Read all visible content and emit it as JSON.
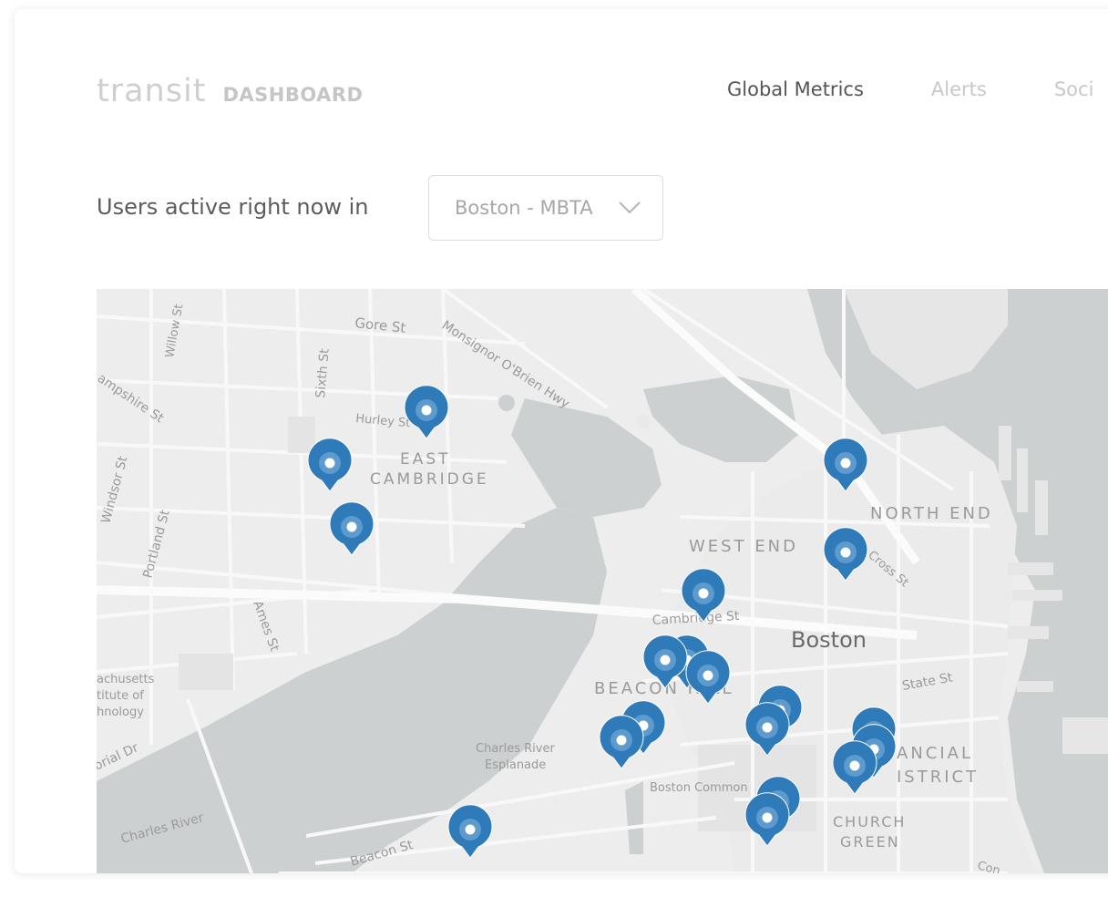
{
  "header": {
    "logo_word": "transit",
    "logo_sub": "DASHBOARD",
    "nav": [
      {
        "label": "Global Metrics",
        "active": true
      },
      {
        "label": "Alerts",
        "active": false
      },
      {
        "label": "Soci",
        "active": false
      }
    ]
  },
  "filter": {
    "prompt": "Users active right now in",
    "selected": "Boston - MBTA"
  },
  "map": {
    "labels": {
      "gore_st": "Gore St",
      "monsignor": "Monsignor O'Brien Hwy",
      "willow_st": "Willow St",
      "sixth_st": "Sixth St",
      "hampshire_st": "ampshire St",
      "hurley_st": "Hurley St",
      "east": "EAST",
      "cambridge": "CAMBRIDGE",
      "windsor_st": "Windsor St",
      "portland_st": "Portland St",
      "north_end": "NORTH END",
      "west_end": "WEST END",
      "cross_st": "Cross St",
      "cambridge_st": "Cambridge St",
      "boston": "Boston",
      "ames_st": "Ames St",
      "mit_1": "achusetts",
      "mit_2": "titute of",
      "mit_3": "hnology",
      "beacon_hill": "BEACON HILL",
      "state_st": "State St",
      "memorial_dr": "orial Dr",
      "esplanade_1": "Charles River",
      "esplanade_2": "Esplanade",
      "financial_1": "ANCIAL",
      "financial_2": "ISTRICT",
      "boston_common": "Boston Common",
      "charles_river": "Charles River",
      "church_1": "CHURCH",
      "church_2": "GREEN",
      "beacon_st": "Beacon St",
      "con": "Con"
    },
    "pin_color": "#2f7ab9",
    "active_user_pins": 19
  }
}
